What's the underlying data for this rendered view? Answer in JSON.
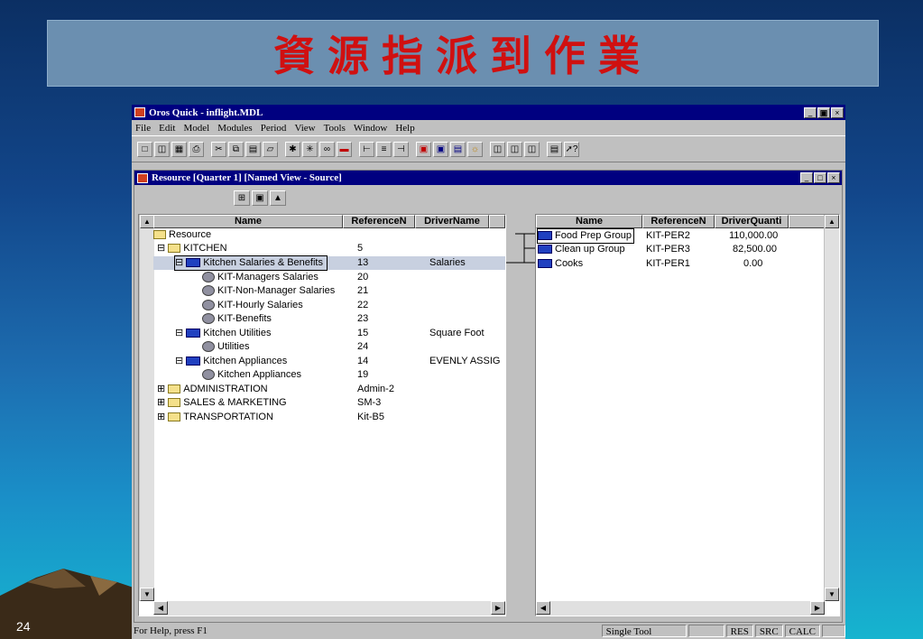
{
  "slide": {
    "title": "資源指派到作業",
    "page_number": "24"
  },
  "app": {
    "title": "Oros Quick - inflight.MDL",
    "menu": [
      "File",
      "Edit",
      "Model",
      "Modules",
      "Period",
      "View",
      "Tools",
      "Window",
      "Help"
    ]
  },
  "child": {
    "title": "Resource [Quarter 1] [Named View - Source]",
    "left_columns": [
      "Name",
      "ReferenceN",
      "DriverName"
    ],
    "right_columns": [
      "Name",
      "ReferenceN",
      "DriverQuanti"
    ],
    "left_rows": [
      {
        "name": "Resource",
        "ref": "",
        "driver": ""
      },
      {
        "name": "KITCHEN",
        "ref": "5",
        "driver": ""
      },
      {
        "name": "Kitchen Salaries & Benefits",
        "ref": "13",
        "driver": "Salaries"
      },
      {
        "name": "KIT-Managers Salaries",
        "ref": "20",
        "driver": ""
      },
      {
        "name": "KIT-Non-Manager Salaries",
        "ref": "21",
        "driver": ""
      },
      {
        "name": "KIT-Hourly Salaries",
        "ref": "22",
        "driver": ""
      },
      {
        "name": "KIT-Benefits",
        "ref": "23",
        "driver": ""
      },
      {
        "name": "Kitchen Utilities",
        "ref": "15",
        "driver": "Square Foot"
      },
      {
        "name": "Utilities",
        "ref": "24",
        "driver": ""
      },
      {
        "name": "Kitchen Appliances",
        "ref": "14",
        "driver": "EVENLY ASSIG"
      },
      {
        "name": "Kitchen Appliances",
        "ref": "19",
        "driver": ""
      },
      {
        "name": "ADMINISTRATION",
        "ref": "Admin-2",
        "driver": ""
      },
      {
        "name": "SALES & MARKETING",
        "ref": "SM-3",
        "driver": ""
      },
      {
        "name": "TRANSPORTATION",
        "ref": "Kit-B5",
        "driver": ""
      }
    ],
    "right_rows": [
      {
        "name": "Food Prep Group",
        "ref": "KIT-PER2",
        "qty": "110,000.00"
      },
      {
        "name": "Clean up Group",
        "ref": "KIT-PER3",
        "qty": "82,500.00"
      },
      {
        "name": "Cooks",
        "ref": "KIT-PER1",
        "qty": "0.00"
      }
    ]
  },
  "status": {
    "help": "For Help, press F1",
    "tool": "Single Tool",
    "res": "RES",
    "src": "SRC",
    "calc": "CALC"
  }
}
